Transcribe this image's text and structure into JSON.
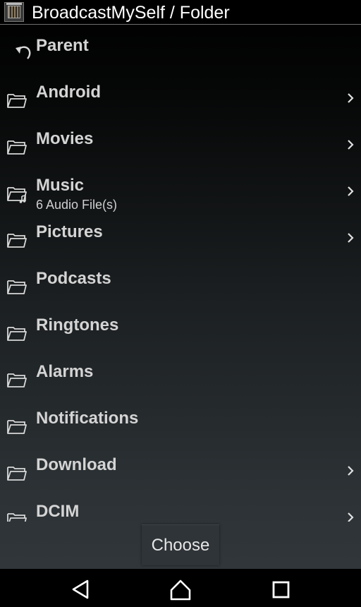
{
  "header": {
    "title": "BroadcastMySelf / Folder",
    "app_icon": "app-launcher-icon"
  },
  "list": {
    "parent_label": "Parent",
    "folders": [
      {
        "name": "Android",
        "subtitle": "",
        "has_chevron": true,
        "icon": "folder-icon"
      },
      {
        "name": "Movies",
        "subtitle": "",
        "has_chevron": true,
        "icon": "folder-icon"
      },
      {
        "name": "Music",
        "subtitle": "6 Audio File(s)",
        "has_chevron": true,
        "icon": "music-folder-icon"
      },
      {
        "name": "Pictures",
        "subtitle": "",
        "has_chevron": true,
        "icon": "folder-icon"
      },
      {
        "name": "Podcasts",
        "subtitle": "",
        "has_chevron": false,
        "icon": "folder-icon"
      },
      {
        "name": "Ringtones",
        "subtitle": "",
        "has_chevron": false,
        "icon": "folder-icon"
      },
      {
        "name": "Alarms",
        "subtitle": "",
        "has_chevron": false,
        "icon": "folder-icon"
      },
      {
        "name": "Notifications",
        "subtitle": "",
        "has_chevron": false,
        "icon": "folder-icon"
      },
      {
        "name": "Download",
        "subtitle": "",
        "has_chevron": true,
        "icon": "folder-icon"
      },
      {
        "name": "DCIM",
        "subtitle": "",
        "has_chevron": true,
        "icon": "folder-icon"
      }
    ]
  },
  "footer": {
    "choose_label": "Choose"
  },
  "navbar": {
    "back": "back-icon",
    "home": "home-icon",
    "recents": "recents-icon"
  },
  "colors": {
    "text": "#d4d4d4",
    "title_text": "#ffffff",
    "divider": "#6c6f71",
    "button_bg": "#2f3438"
  }
}
